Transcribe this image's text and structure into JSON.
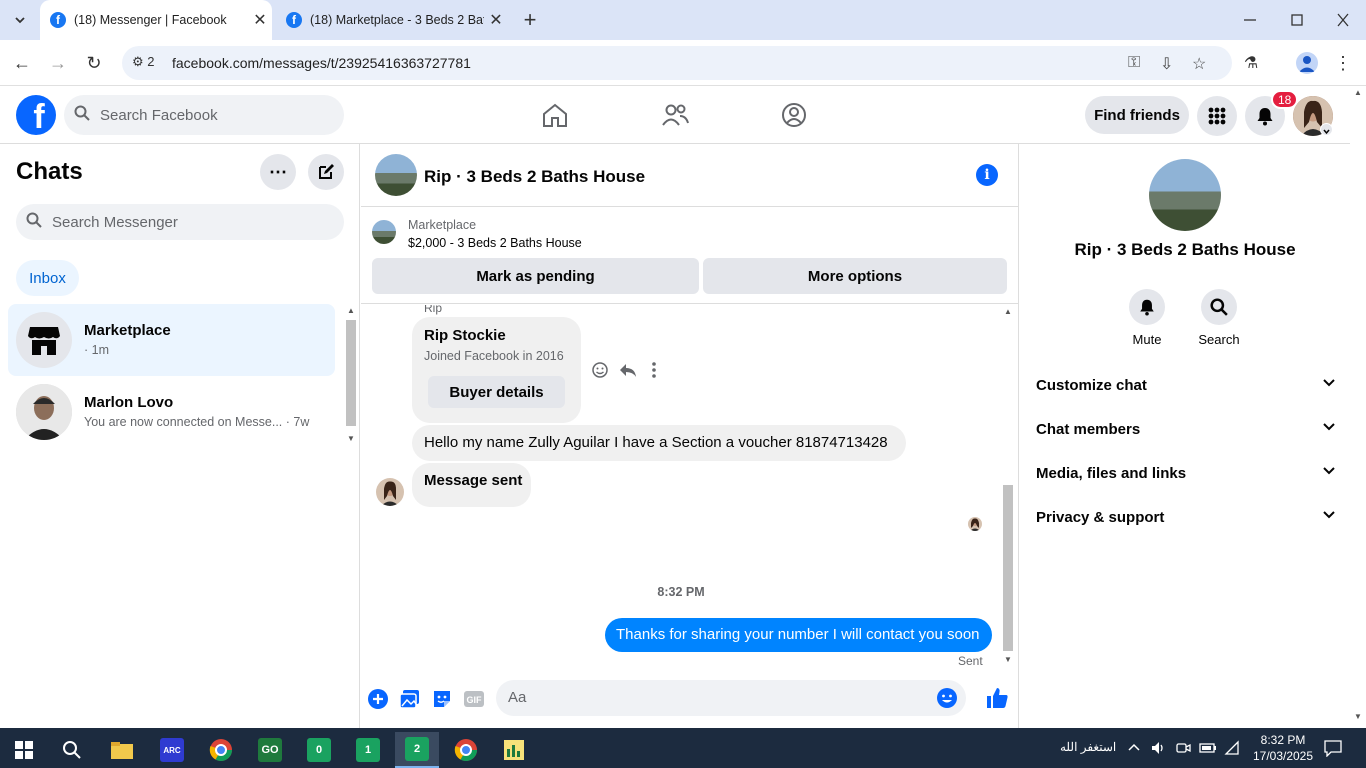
{
  "browser": {
    "tabs": [
      {
        "title": "(18) Messenger | Facebook",
        "active": true
      },
      {
        "title": "(18) Marketplace - 3 Beds 2 Bat",
        "active": false
      }
    ],
    "site_info_count": "2",
    "url": "facebook.com/messages/t/23925416363727781"
  },
  "header": {
    "search_placeholder": "Search Facebook",
    "find_friends": "Find friends",
    "notification_count": "18"
  },
  "left": {
    "title": "Chats",
    "search_placeholder": "Search Messenger",
    "inbox_label": "Inbox",
    "chats": [
      {
        "name": "Marketplace",
        "preview": "· 1m",
        "selected": true
      },
      {
        "name": "Marlon Lovo",
        "preview": "You are now connected on Messe... · 7w",
        "selected": false
      }
    ]
  },
  "conversation": {
    "title": "Rip · 3 Beds 2 Baths House",
    "marketplace_label": "Marketplace",
    "listing": "$2,000 - 3 Beds 2 Baths House",
    "mark_pending": "Mark as pending",
    "more_options": "More options",
    "sender_label": "Rip",
    "card_name": "Rip Stockie",
    "card_joined": "Joined Facebook in 2016",
    "buyer_details": "Buyer details",
    "msg_voucher": "Hello my name Zully Aguilar I have a Section a voucher  81874713428",
    "msg_sent": "Message sent",
    "time_divider": "8:32 PM",
    "my_message": "Thanks for sharing your number I will contact you soon",
    "sent_status": "Sent",
    "input_placeholder": "Aa"
  },
  "right": {
    "title": "Rip · 3 Beds 2 Baths House",
    "actions": [
      {
        "label": "Mute"
      },
      {
        "label": "Search"
      }
    ],
    "sections": [
      {
        "label": "Customize chat"
      },
      {
        "label": "Chat members"
      },
      {
        "label": "Media, files and links"
      },
      {
        "label": "Privacy & support"
      }
    ]
  },
  "taskbar": {
    "arabic_text": "استغفر الله",
    "time": "8:32 PM",
    "date": "17/03/2025",
    "app_badges": [
      "0",
      "1",
      "2"
    ]
  },
  "colors": {
    "fb_blue": "#0866ff",
    "my_bubble": "#0084ff",
    "badge_red": "#e41e3f"
  }
}
